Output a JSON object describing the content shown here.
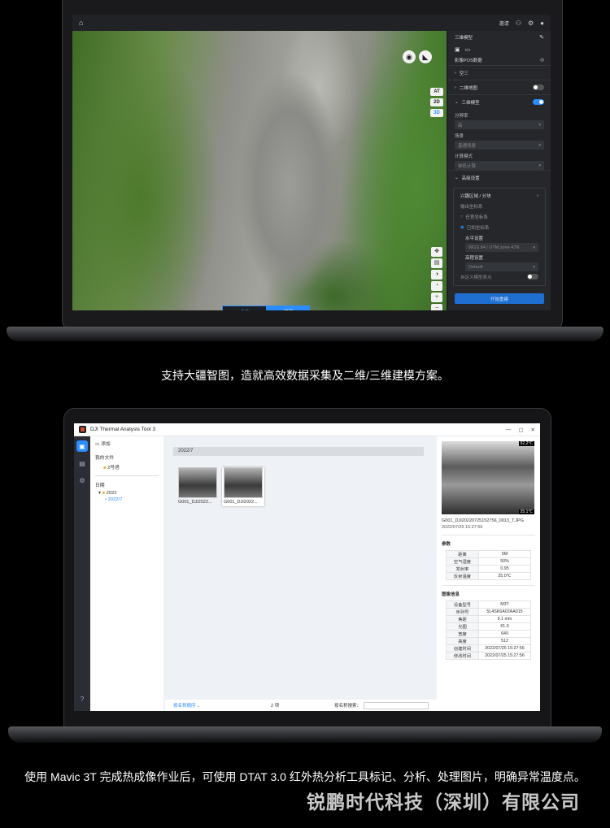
{
  "laptop1": {
    "topbar_right": [
      "邀请"
    ],
    "icons": {
      "home": "home-icon",
      "share": "share-icon",
      "settings": "gear-icon",
      "user": "user-icon"
    },
    "view_modes": [
      "AT",
      "2D",
      "3D"
    ],
    "active_view": "3D",
    "segment": {
      "left": "点云",
      "right": "模型"
    },
    "panel": {
      "title": "三维模型",
      "pos_label": "影像POS数据",
      "aerial": "空三",
      "twod_map": "二维地图",
      "threed_model": "三维模型",
      "resolution_label": "分辨率",
      "resolution_value": "高",
      "scene_label": "场景",
      "scene_value": "普通场景",
      "compute_label": "计算模式",
      "compute_value": "单机计算",
      "advanced": "高级设置",
      "region": "兴趣区域 / 分块",
      "output_crs": "输出坐标系",
      "opt_any": "任意坐标系",
      "opt_known": "已知坐标系",
      "horizontal": "水平设置",
      "horizontal_value": "WGS 84 / UTM zone 47N",
      "elevation": "高程设置",
      "elevation_value": "Default",
      "custom_origin": "自定义模型原点",
      "start_button": "开始重建"
    }
  },
  "caption1": "支持大疆智图，造就高效数据采集及二维/三维建模方案。",
  "laptop2": {
    "window_title": "DJI Thermal Analysis Tool 3",
    "window_controls": [
      "—",
      "▢",
      "✕"
    ],
    "tree": {
      "add": "添加",
      "my_files": "我的文件",
      "folder": "2号塔",
      "date": "日期",
      "year": "2022",
      "month": "2022/7"
    },
    "date_header": "2022/7",
    "thumbnails": [
      "G001_DJI2022...",
      "G001_DJI2022..."
    ],
    "footer": {
      "sort": "按名称顺序",
      "count": "2 项",
      "search_label": "按名称搜索："
    },
    "detail": {
      "temp_high": "52.2℃",
      "temp_low": "25.1℃",
      "filename": "G001_DJI20220725152756_0013_T.JPG",
      "datetime": "2022/07/25 15:27:56",
      "params_title": "参数",
      "params": [
        [
          "距离",
          "5M"
        ],
        [
          "空气湿度",
          "50%"
        ],
        [
          "发射率",
          "0.95"
        ],
        [
          "反射温度",
          "25.0℃"
        ]
      ],
      "info_title": "图像信息",
      "info": [
        [
          "设备型号",
          "M3T"
        ],
        [
          "序列号",
          "5L4SK6A02AA015"
        ],
        [
          "焦距",
          "9.1 mm"
        ],
        [
          "光圈",
          "f/1.0"
        ],
        [
          "宽度",
          "640"
        ],
        [
          "高度",
          "512"
        ],
        [
          "创建时间",
          "2022/07/25 15:27:56"
        ],
        [
          "修改时间",
          "2022/07/25 15:27:56"
        ]
      ]
    }
  },
  "caption2": "使用 Mavic 3T 完成热成像作业后，可使用 DTAT 3.0 红外热分析工具标记、分析、处理图片，明确异常温度点。",
  "watermark": "锐鹏时代科技（深圳）有限公司"
}
